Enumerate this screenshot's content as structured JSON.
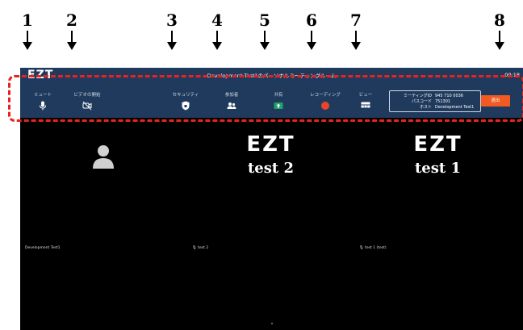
{
  "annotations": [
    "1",
    "2",
    "3",
    "4",
    "5",
    "6",
    "7",
    "8"
  ],
  "window": {
    "logo": "EZT",
    "title": "Development Test1のパーソナルミーティングルーム",
    "clock": "00:18"
  },
  "toolbar": {
    "mute_label": "ミュート",
    "video_label": "ビデオの開始",
    "security_label": "セキュリティ",
    "participants_label": "参加者",
    "share_label": "共有",
    "recording_label": "レコーディング",
    "view_label": "ビュー",
    "exit_label": "退出"
  },
  "meeting_info": {
    "id_label": "ミーティングID",
    "id_value": "945 710 0036",
    "passcode_label": "パスコード",
    "passcode_value": "751301",
    "host_label": "ホスト",
    "host_value": "Development Test1"
  },
  "tiles": [
    {
      "name": "Development Test1",
      "logo": "",
      "sub": ""
    },
    {
      "name": "🎙 test 2",
      "logo": "EZT",
      "sub": "test 2"
    },
    {
      "name": "🎙 test 1 (test)",
      "logo": "EZT",
      "sub": "test 1"
    }
  ],
  "colors": {
    "titlebar": "#1f3a5c",
    "exit": "#f25a22",
    "annotation_dash": "#e8231f",
    "share_icon": "#1fa36b",
    "record_icon": "#e8452c"
  },
  "icons": [
    "microphone-icon",
    "video-off-icon",
    "shield-icon",
    "participants-icon",
    "share-screen-icon",
    "record-icon",
    "view-grid-icon",
    "person-avatar-icon"
  ]
}
